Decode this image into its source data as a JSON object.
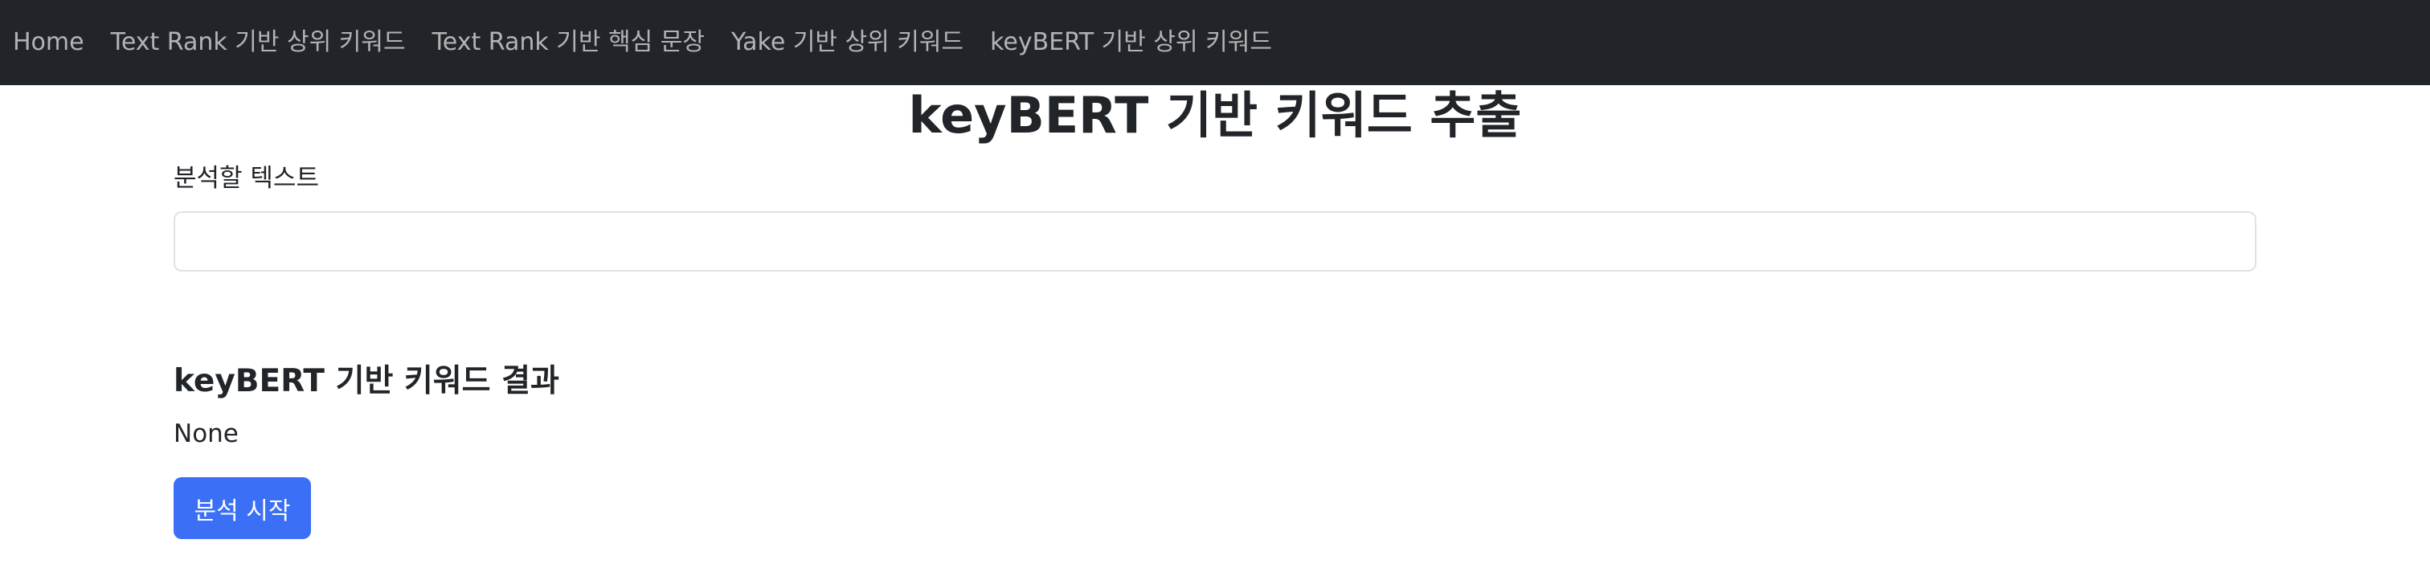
{
  "nav": {
    "items": [
      {
        "label": "Home"
      },
      {
        "label": "Text Rank 기반 상위 키워드"
      },
      {
        "label": "Text Rank 기반 핵심 문장"
      },
      {
        "label": "Yake 기반 상위 키워드"
      },
      {
        "label": "keyBERT 기반 상위 키워드"
      }
    ]
  },
  "main": {
    "title": "keyBERT 기반 키워드 추출",
    "input_label": "분석할 텍스트",
    "input_value": "",
    "result_heading": "keyBERT 기반 키워드 결과",
    "result_value": "None",
    "submit_label": "분석 시작"
  },
  "colors": {
    "navbar_bg": "#212529",
    "primary_button": "#3b6ff6"
  }
}
